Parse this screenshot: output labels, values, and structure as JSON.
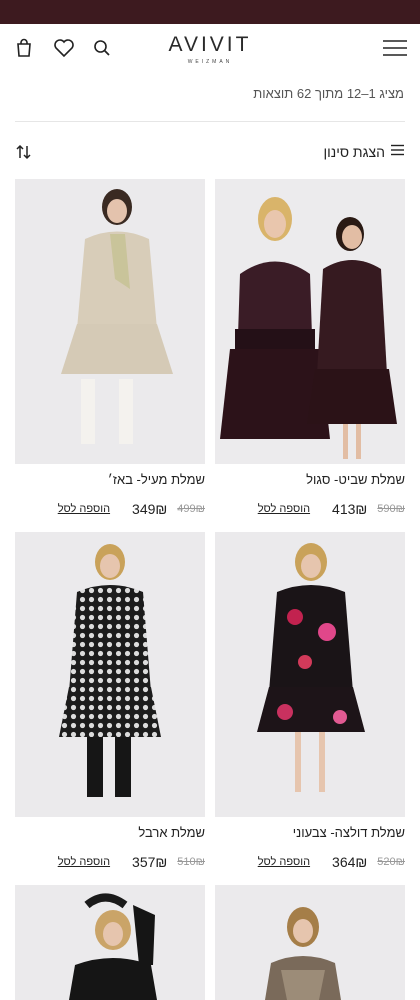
{
  "topbar": {
    "color": "#3d1a1f"
  },
  "header": {
    "logo_main": "AVIVIT",
    "logo_sub": "WEIZMAN",
    "icons": [
      "cart-icon",
      "heart-icon",
      "search-icon",
      "hamburger-menu-icon"
    ]
  },
  "results_text": "מציג 1–12 מתוך 62 תוצאות",
  "filter": {
    "label": "הצגת סינון",
    "icon": "filter-lines-icon"
  },
  "sort": {
    "icon": "sort-arrows-icon"
  },
  "products": [
    {
      "title": "שמלת שביט- סגול",
      "old_price": "590₪",
      "price": "413₪",
      "add_to_cart": "הוספה לסל",
      "image": "two-models-dark-purple-lace-dresses"
    },
    {
      "title": "שמלת מעיל- באז׳",
      "old_price": "499₪",
      "price": "349₪",
      "add_to_cart": "הוספה לסל",
      "image": "model-beige-trench-dress"
    },
    {
      "title": "שמלת דולצה- צבעוני",
      "old_price": "520₪",
      "price": "364₪",
      "add_to_cart": "הוספה לסל",
      "image": "model-black-floral-dress"
    },
    {
      "title": "שמלת ארבל",
      "old_price": "510₪",
      "price": "357₪",
      "add_to_cart": "הוספה לסל",
      "image": "model-polka-pattern-dress"
    },
    {
      "title": "",
      "old_price": "",
      "price": "",
      "add_to_cart": "",
      "image": "model-black-leather-top"
    },
    {
      "title": "",
      "old_price": "",
      "price": "",
      "add_to_cart": "",
      "image": "model-metallic-dress"
    }
  ]
}
